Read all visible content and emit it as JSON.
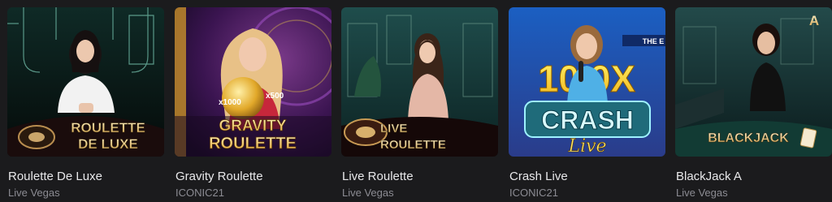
{
  "games": [
    {
      "title": "Roulette De Luxe",
      "provider": "Live Vegas",
      "logo_line1": "ROULETTE",
      "logo_line2": "DE LUXE"
    },
    {
      "title": "Gravity Roulette",
      "provider": "ICONIC21",
      "logo_line1": "GRAVITY",
      "logo_line2": "ROULETTE",
      "multiplier_a": "x1000",
      "multiplier_b": "x500"
    },
    {
      "title": "Live Roulette",
      "provider": "Live Vegas",
      "logo_line1": "LIVE",
      "logo_line2": "ROULETTE"
    },
    {
      "title": "Crash Live",
      "provider": "ICONIC21",
      "logo_line1": "CRASH",
      "logo_line2": "Live",
      "banner": "10 0X",
      "tag": "THE E"
    },
    {
      "title": "BlackJack A",
      "provider": "Live Vegas",
      "logo_line1": "BLACKJACK",
      "corner_letter": "A"
    }
  ]
}
